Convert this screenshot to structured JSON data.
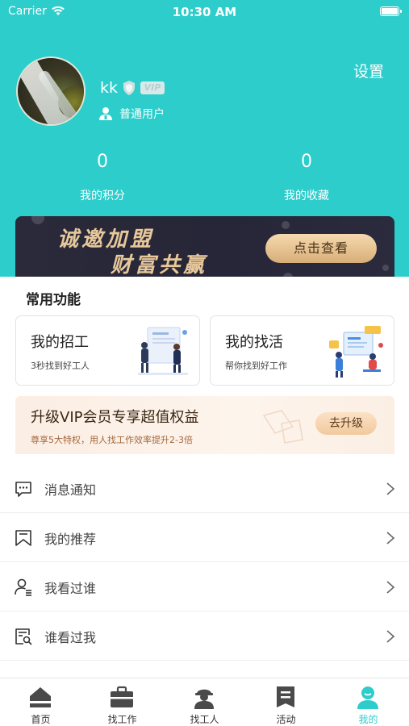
{
  "status_bar": {
    "carrier": "Carrier",
    "time": "10:30 AM"
  },
  "profile": {
    "username": "kk",
    "vip_label": "VIP",
    "user_type": "普通用户",
    "settings": "设置"
  },
  "stats": [
    {
      "value": "0",
      "label": "我的积分"
    },
    {
      "value": "0",
      "label": "我的收藏"
    }
  ],
  "banner": {
    "line1": "诚邀加盟",
    "line2": "财富共赢",
    "cta": "点击查看"
  },
  "common_functions": {
    "title": "常用功能",
    "cards": [
      {
        "title": "我的招工",
        "subtitle": "3秒找到好工人",
        "icon": "recruit-illustration"
      },
      {
        "title": "我的找活",
        "subtitle": "帮你找到好工作",
        "icon": "job-search-illustration"
      }
    ]
  },
  "vip_upgrade": {
    "title": "升级VIP会员专享超值权益",
    "subtitle": "尊享5大特权，用人找工作效率提升2-3倍",
    "button": "去升级"
  },
  "menu": [
    {
      "label": "消息通知",
      "icon": "message-icon"
    },
    {
      "label": "我的推荐",
      "icon": "bookmark-icon"
    },
    {
      "label": "我看过谁",
      "icon": "user-list-icon"
    },
    {
      "label": "谁看过我",
      "icon": "search-doc-icon"
    }
  ],
  "tabbar": [
    {
      "label": "首页",
      "icon": "home-icon"
    },
    {
      "label": "找工作",
      "icon": "briefcase-icon"
    },
    {
      "label": "找工人",
      "icon": "worker-icon"
    },
    {
      "label": "活动",
      "icon": "activity-icon"
    },
    {
      "label": "我的",
      "icon": "profile-icon",
      "active": true
    }
  ],
  "colors": {
    "primary": "#2ccdcb",
    "banner_gold": "#e7c89a",
    "vip_text": "#a5663a"
  }
}
